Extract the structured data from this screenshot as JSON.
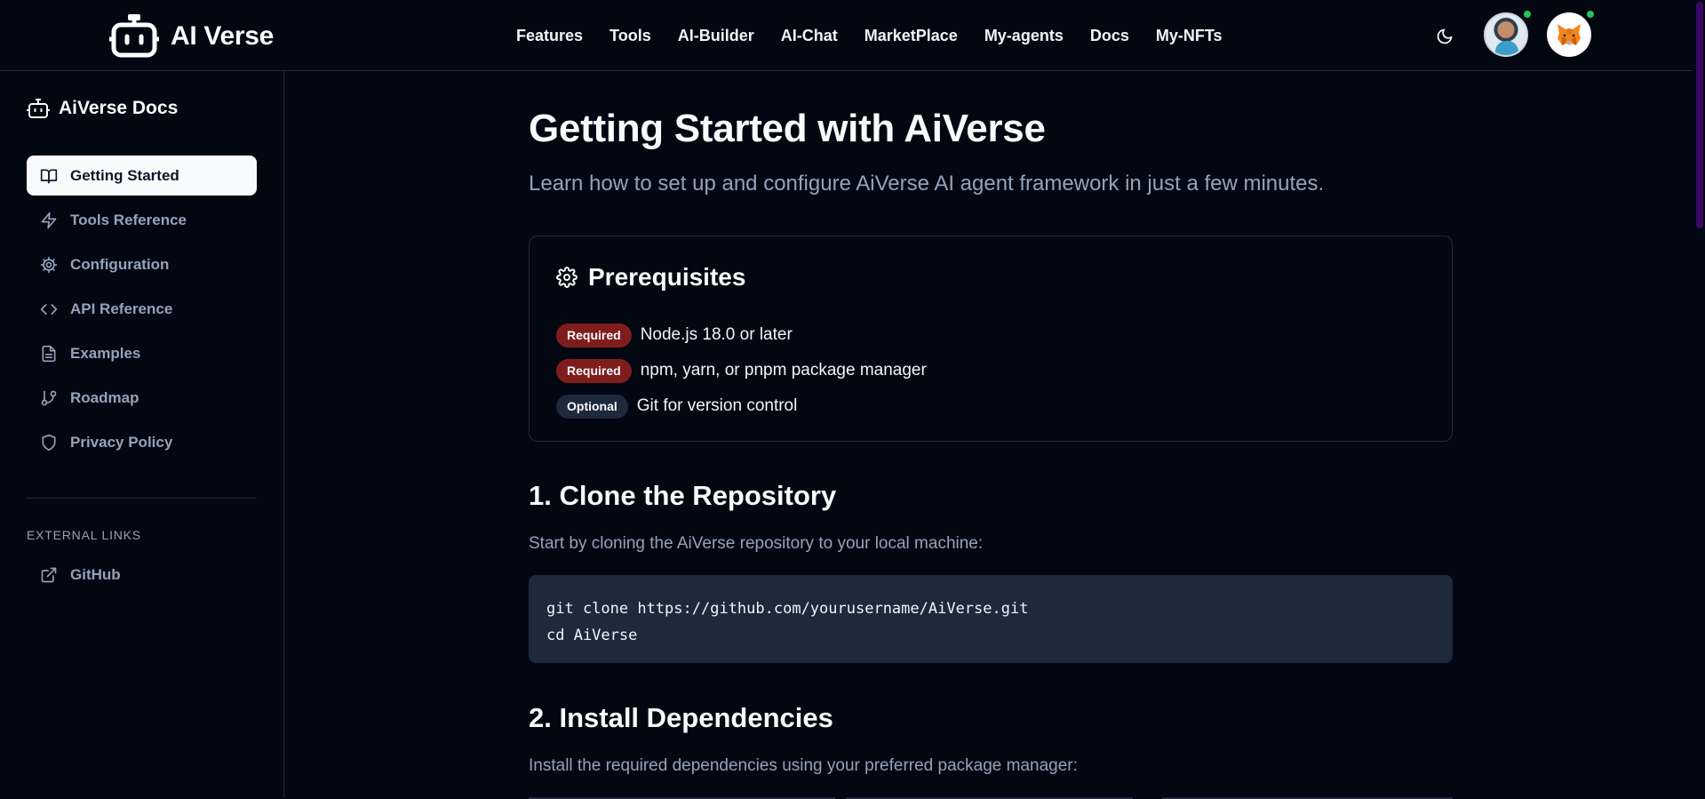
{
  "navbar": {
    "brand": "AI Verse",
    "links": [
      "Features",
      "Tools",
      "AI-Builder",
      "AI-Chat",
      "MarketPlace",
      "My-agents",
      "Docs",
      "My-NFTs"
    ],
    "theme_icon": "moon-icon",
    "user_avatar": "user-avatar",
    "wallet_avatar": "metamask-fox-icon",
    "status_color": "#22c55e"
  },
  "sidebar": {
    "title": "AiVerse Docs",
    "items": [
      {
        "label": "Getting Started",
        "icon": "book-open-icon",
        "active": true
      },
      {
        "label": "Tools Reference",
        "icon": "zap-icon",
        "active": false
      },
      {
        "label": "Configuration",
        "icon": "gear-icon",
        "active": false
      },
      {
        "label": "API Reference",
        "icon": "code-icon",
        "active": false
      },
      {
        "label": "Examples",
        "icon": "file-text-icon",
        "active": false
      },
      {
        "label": "Roadmap",
        "icon": "git-branch-icon",
        "active": false
      },
      {
        "label": "Privacy Policy",
        "icon": "shield-icon",
        "active": false
      }
    ],
    "external_section": "EXTERNAL LINKS",
    "external": [
      {
        "label": "GitHub",
        "icon": "external-link-icon"
      }
    ]
  },
  "main": {
    "title": "Getting Started with AiVerse",
    "subtitle": "Learn how to set up and configure AiVerse AI agent framework in just a few minutes.",
    "prereq": {
      "title": "Prerequisites",
      "items": [
        {
          "badge": "Required",
          "text": "Node.js 18.0 or later"
        },
        {
          "badge": "Required",
          "text": "npm, yarn, or pnpm package manager"
        },
        {
          "badge": "Optional",
          "text": "Git for version control"
        }
      ]
    },
    "step1": {
      "title": "1. Clone the Repository",
      "desc": "Start by cloning the AiVerse repository to your local machine:",
      "code": [
        "git clone https://github.com/yourusername/AiVerse.git",
        "cd AiVerse"
      ]
    },
    "step2": {
      "title": "2. Install Dependencies",
      "desc": "Install the required dependencies using your preferred package manager:"
    }
  },
  "colors": {
    "background": "#030712",
    "required_badge": "#7f1d1d",
    "optional_badge": "#1e293b",
    "code_bg": "#1e293b",
    "muted_text": "#94a3b8",
    "scrollbar": "#3b0764"
  }
}
